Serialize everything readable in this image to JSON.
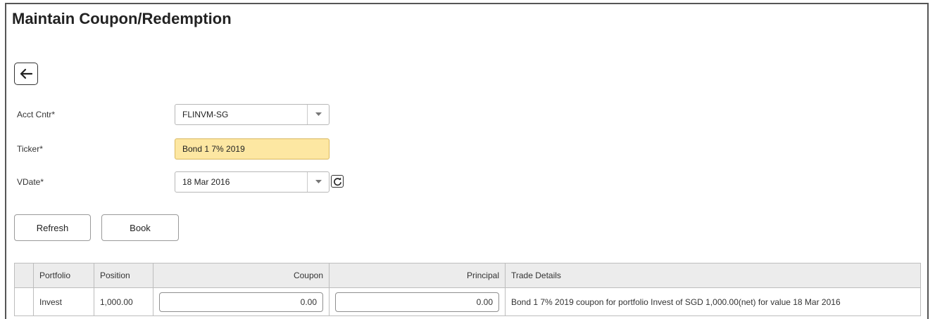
{
  "page": {
    "title": "Maintain Coupon/Redemption"
  },
  "form": {
    "acct_cntr": {
      "label": "Acct Cntr*",
      "value": "FLINVM-SG"
    },
    "ticker": {
      "label": "Ticker*",
      "value": "Bond 1 7% 2019"
    },
    "vdate": {
      "label": "VDate*",
      "value": "18 Mar 2016"
    }
  },
  "buttons": {
    "refresh": "Refresh",
    "book": "Book"
  },
  "colors": {
    "ticker_highlight": "#fde7a2"
  },
  "icons": {
    "back": "arrow-left-icon",
    "dropdown": "chevron-down-icon",
    "reload": "reload-icon"
  },
  "table": {
    "columns": [
      "",
      "Portfolio",
      "Position",
      "Coupon",
      "Principal",
      "Trade Details"
    ],
    "rows": [
      {
        "portfolio": "Invest",
        "position": "1,000.00",
        "coupon": "0.00",
        "principal": "0.00",
        "trade_details": "Bond 1 7% 2019 coupon for portfolio Invest of SGD 1,000.00(net) for value 18 Mar 2016"
      }
    ]
  }
}
